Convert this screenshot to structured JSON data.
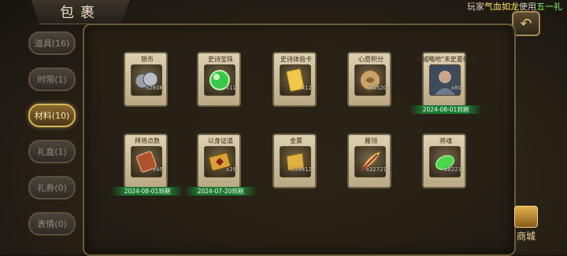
{
  "header": {
    "title": "包裹",
    "marquee_prefix": "玩家",
    "marquee_name": "气血如龙",
    "marquee_mid": "使用",
    "marquee_item": "五一礼"
  },
  "tabs": [
    {
      "label": "道具(16)",
      "active": false
    },
    {
      "label": "时限(1)",
      "active": false
    },
    {
      "label": "材料(10)",
      "active": true
    },
    {
      "label": "礼盒(1)",
      "active": false
    },
    {
      "label": "礼券(0)",
      "active": false
    },
    {
      "label": "表情(0)",
      "active": false
    }
  ],
  "items": [
    {
      "name": "银币",
      "qty": "x2808",
      "expiry": "",
      "icon": "silver-coin-icon",
      "color": "#9aa0a6"
    },
    {
      "name": "史诗宝珠",
      "qty": "x11",
      "expiry": "",
      "icon": "green-orb-icon",
      "color": "#37c84a"
    },
    {
      "name": "史诗体验卡",
      "qty": "x12",
      "expiry": "",
      "icon": "gold-card-icon",
      "color": "#f1c84a"
    },
    {
      "name": "心愿积分",
      "qty": "x4520",
      "expiry": "",
      "icon": "wish-coin-icon",
      "color": "#c9a26b"
    },
    {
      "name": "攻城略地\"末史夏碎片",
      "qty": "x80",
      "expiry": "2024-08-01到期",
      "icon": "hero-portrait-icon",
      "color": "#6c7a8a"
    },
    {
      "name": "拜将点数",
      "qty": "x45",
      "expiry": "2024-08-01到期",
      "icon": "general-token-icon",
      "color": "#b0522e"
    },
    {
      "name": "以身证道",
      "qty": "x29",
      "expiry": "2024-07-20到期",
      "icon": "gold-plaque-icon",
      "color": "#d9a034"
    },
    {
      "name": "金票",
      "qty": "x14812",
      "expiry": "",
      "icon": "gold-ticket-icon",
      "color": "#e0b13e"
    },
    {
      "name": "雁翎",
      "qty": "x32721",
      "expiry": "",
      "icon": "feather-icon",
      "color": "#d8c27a"
    },
    {
      "name": "将魂",
      "qty": "x8223",
      "expiry": "",
      "icon": "soul-jade-icon",
      "color": "#4cd64a"
    }
  ],
  "shop": {
    "label": "商城"
  }
}
